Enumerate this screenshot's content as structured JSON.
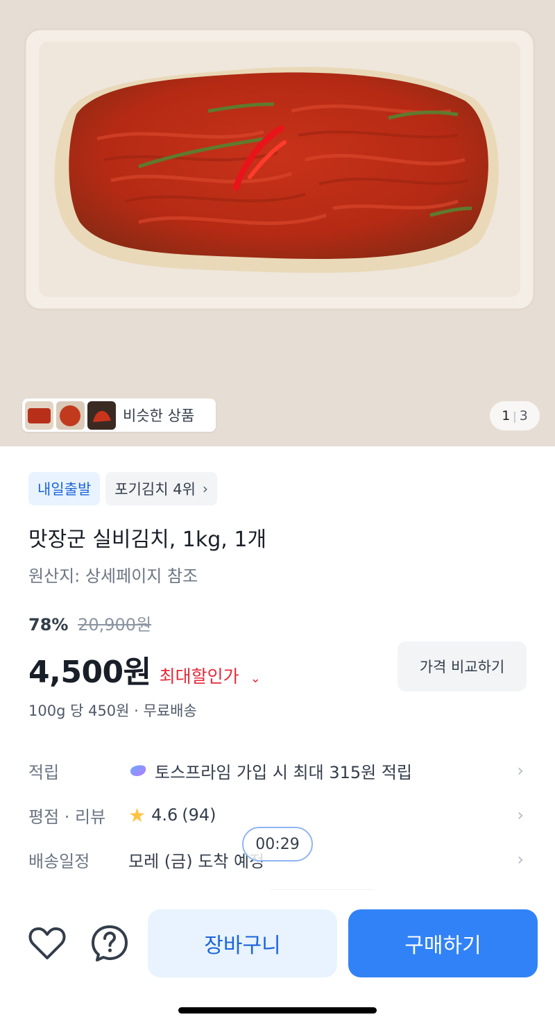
{
  "gallery": {
    "similar_label": "비슷한 상품",
    "page_current": "1",
    "page_separator": "|",
    "page_total": "3"
  },
  "badges": {
    "shipping": "내일출발",
    "ranking": "포기김치 4위"
  },
  "product": {
    "title": "맛장군 실비김치, 1kg, 1개",
    "origin": "원산지: 상세페이지 참조",
    "discount_rate": "78%",
    "original_price": "20,900원",
    "price": "4,500원",
    "max_discount_label": "최대할인가",
    "unit_price": "100g 당 450원 · 무료배송",
    "compare_button": "가격 비교하기"
  },
  "info": {
    "rows": [
      {
        "key": "적립",
        "value": "토스프라임 가입 시 최대 315원 적립"
      },
      {
        "key": "평점 · 리뷰",
        "rating": "4.6",
        "count": "(94)"
      },
      {
        "key": "배송일정",
        "value": "모레 (금) 도착 예정"
      }
    ]
  },
  "timer": "00:29",
  "bottom_bar": {
    "cart_label": "장바구니",
    "buy_label": "구매하기"
  },
  "colors": {
    "primary": "#3182f6",
    "primary_light": "#e8f3ff",
    "discount_red": "#e42939",
    "star": "#ffc342"
  },
  "icons": [
    "heart-icon",
    "question-icon",
    "chevron-right-icon",
    "chevron-down-icon",
    "star-icon",
    "toss-prime-icon"
  ]
}
